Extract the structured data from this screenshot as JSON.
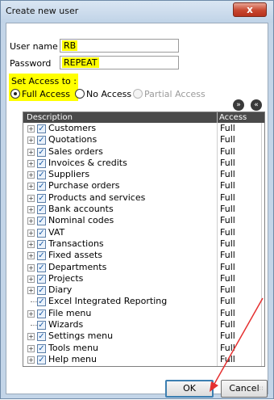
{
  "window": {
    "title": "Create new user",
    "close_label": "x"
  },
  "form": {
    "username_label": "User name",
    "username_value": "RB",
    "password_label": "Password",
    "password_value": "REPEAT"
  },
  "access": {
    "heading": "Set Access to :",
    "options": [
      {
        "label": "Full Access",
        "selected": true,
        "enabled": true
      },
      {
        "label": "No Access",
        "selected": false,
        "enabled": true
      },
      {
        "label": "Partial Access",
        "selected": false,
        "enabled": false
      }
    ],
    "expand_all_icon": "double-chevron-down-icon",
    "collapse_all_icon": "double-chevron-up-icon"
  },
  "grid": {
    "columns": [
      "Description",
      "Access"
    ],
    "rows": [
      {
        "label": "Customers",
        "access": "Full",
        "expandable": true
      },
      {
        "label": "Quotations",
        "access": "Full",
        "expandable": true
      },
      {
        "label": "Sales orders",
        "access": "Full",
        "expandable": true
      },
      {
        "label": "Invoices & credits",
        "access": "Full",
        "expandable": true
      },
      {
        "label": "Suppliers",
        "access": "Full",
        "expandable": true
      },
      {
        "label": "Purchase orders",
        "access": "Full",
        "expandable": true
      },
      {
        "label": "Products and services",
        "access": "Full",
        "expandable": true
      },
      {
        "label": "Bank accounts",
        "access": "Full",
        "expandable": true
      },
      {
        "label": "Nominal codes",
        "access": "Full",
        "expandable": true
      },
      {
        "label": "VAT",
        "access": "Full",
        "expandable": true
      },
      {
        "label": "Transactions",
        "access": "Full",
        "expandable": true
      },
      {
        "label": "Fixed assets",
        "access": "Full",
        "expandable": true
      },
      {
        "label": "Departments",
        "access": "Full",
        "expandable": true
      },
      {
        "label": "Projects",
        "access": "Full",
        "expandable": true
      },
      {
        "label": "Diary",
        "access": "Full",
        "expandable": true
      },
      {
        "label": "Excel Integrated Reporting",
        "access": "Full",
        "expandable": false
      },
      {
        "label": "File menu",
        "access": "Full",
        "expandable": true
      },
      {
        "label": "Wizards",
        "access": "Full",
        "expandable": false
      },
      {
        "label": "Settings menu",
        "access": "Full",
        "expandable": true
      },
      {
        "label": "Tools menu",
        "access": "Full",
        "expandable": true
      },
      {
        "label": "Help menu",
        "access": "Full",
        "expandable": true
      }
    ]
  },
  "buttons": {
    "ok": "OK",
    "cancel": "Cancel"
  },
  "colors": {
    "highlight": "#ffff00",
    "annotation_arrow": "#e53030",
    "grid_header": "#4a4a4a"
  }
}
